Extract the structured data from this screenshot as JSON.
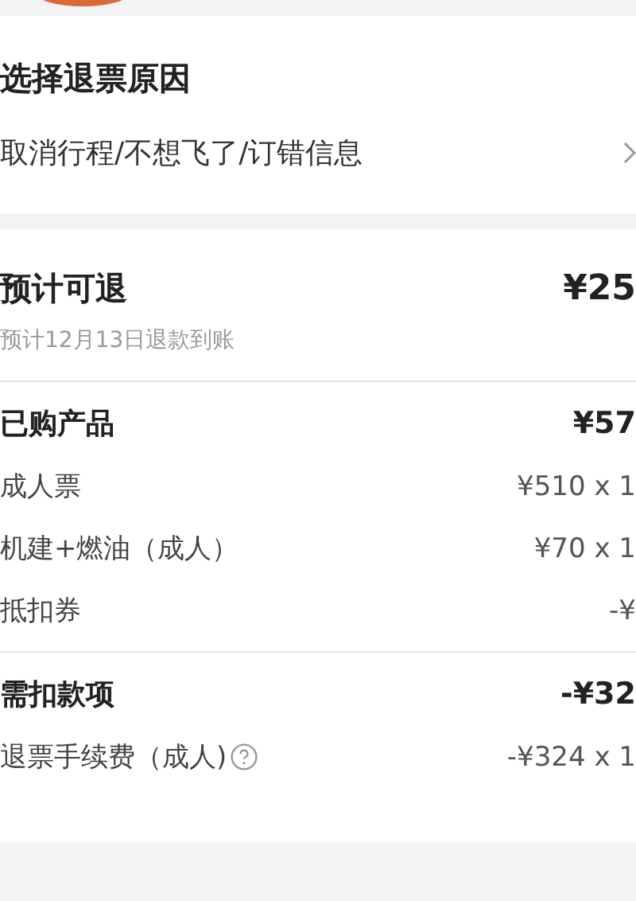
{
  "reason": {
    "title": "选择退票原因",
    "value": "取消行程/不想飞了/订错信息"
  },
  "refund": {
    "title": "预计可退",
    "amount": "¥25",
    "note": "预计12月13日退款到账"
  },
  "sections": [
    {
      "title": "已购产品",
      "total": "¥57",
      "items": [
        {
          "label": "成人票",
          "amount": "¥510 x 1",
          "help": false
        },
        {
          "label": "机建+燃油（成人）",
          "amount": "¥70 x 1",
          "help": false
        },
        {
          "label": "抵扣券",
          "amount": "-¥",
          "help": false
        }
      ]
    },
    {
      "title": "需扣款项",
      "total": "-¥32",
      "items": [
        {
          "label": "退票手续费（成人)",
          "amount": "-¥324 x 1",
          "help": true
        }
      ]
    }
  ]
}
